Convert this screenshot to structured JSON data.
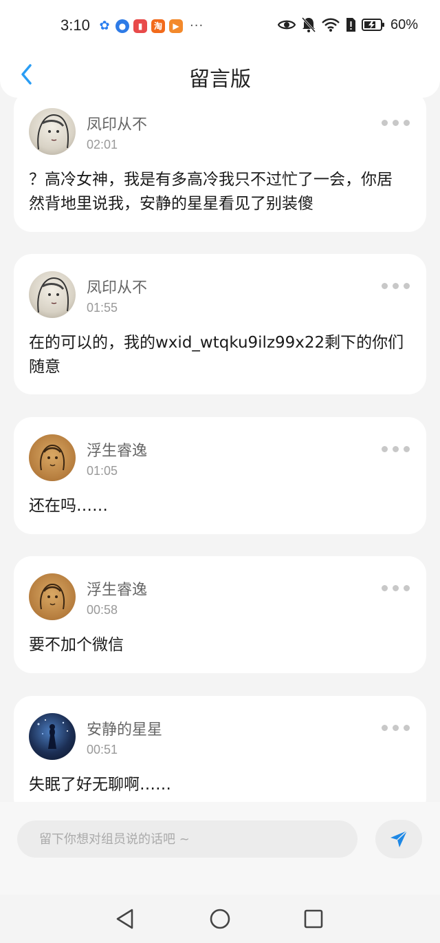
{
  "status_bar": {
    "time": "3:10",
    "more": "···",
    "battery": "60%"
  },
  "header": {
    "title": "留言版",
    "back_icon": "chevron-left-icon"
  },
  "messages": [
    {
      "name": "凤印从不",
      "time": "02:01",
      "text": "？高冷女神，我是有多高冷我只不过忙了一会，你居然背地里说我，安静的星星看见了别装傻"
    },
    {
      "name": "凤印从不",
      "time": "01:55",
      "text": "在的可以的，我的wxid_wtqku9ilz99x22剩下的你们随意"
    },
    {
      "name": "浮生睿逸",
      "time": "01:05",
      "text": "还在吗……"
    },
    {
      "name": "浮生睿逸",
      "time": "00:58",
      "text": "要不加个微信"
    },
    {
      "name": "安静的星星",
      "time": "00:51",
      "text": "失眠了好无聊啊……"
    }
  ],
  "input": {
    "placeholder": "留下你想对组员说的话吧 ~",
    "value": ""
  },
  "colors": {
    "accent": "#2a9df4",
    "send_icon": "#1e88e5"
  }
}
